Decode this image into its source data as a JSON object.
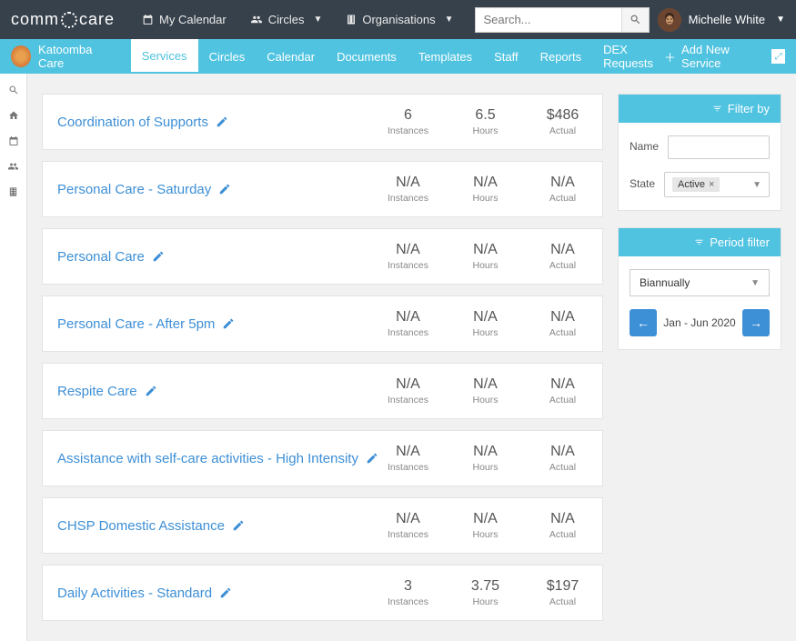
{
  "header": {
    "logo_prefix": "comm",
    "logo_suffix": "care",
    "nav": {
      "calendar": "My Calendar",
      "circles": "Circles",
      "organisations": "Organisations"
    },
    "search_placeholder": "Search...",
    "user_name": "Michelle White"
  },
  "subheader": {
    "org_name": "Katoomba Care",
    "tabs": [
      "Services",
      "Circles",
      "Calendar",
      "Documents",
      "Templates",
      "Staff",
      "Reports",
      "DEX Requests"
    ],
    "active_tab": "Services",
    "add_button": "Add New Service"
  },
  "metric_labels": {
    "instances": "Instances",
    "hours": "Hours",
    "actual": "Actual"
  },
  "services": [
    {
      "name": "Coordination of Supports",
      "instances": "6",
      "hours": "6.5",
      "actual": "$486"
    },
    {
      "name": "Personal Care - Saturday",
      "instances": "N/A",
      "hours": "N/A",
      "actual": "N/A"
    },
    {
      "name": "Personal Care",
      "instances": "N/A",
      "hours": "N/A",
      "actual": "N/A"
    },
    {
      "name": "Personal Care - After 5pm",
      "instances": "N/A",
      "hours": "N/A",
      "actual": "N/A"
    },
    {
      "name": "Respite Care",
      "instances": "N/A",
      "hours": "N/A",
      "actual": "N/A"
    },
    {
      "name": "Assistance with self-care activities - High Intensity",
      "instances": "N/A",
      "hours": "N/A",
      "actual": "N/A"
    },
    {
      "name": "CHSP Domestic Assistance",
      "instances": "N/A",
      "hours": "N/A",
      "actual": "N/A"
    },
    {
      "name": "Daily Activities - Standard",
      "instances": "3",
      "hours": "3.75",
      "actual": "$197"
    }
  ],
  "filter_panel": {
    "title": "Filter by",
    "name_label": "Name",
    "state_label": "State",
    "state_value": "Active"
  },
  "period_panel": {
    "title": "Period filter",
    "frequency": "Biannually",
    "period": "Jan - Jun 2020"
  }
}
